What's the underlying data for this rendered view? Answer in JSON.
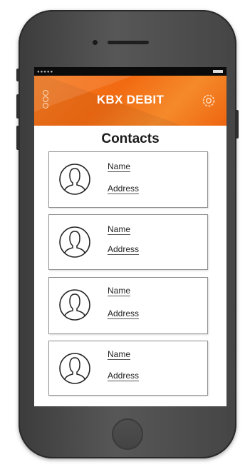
{
  "app": {
    "title": "KBX DEBIT",
    "accent_color": "#f47a1f"
  },
  "header": {
    "menu_icon": "menu-dots-icon",
    "settings_icon": "gear-icon"
  },
  "page": {
    "title": "Contacts"
  },
  "contacts": [
    {
      "name": "Name",
      "address": "Address",
      "avatar_icon": "person-icon"
    },
    {
      "name": "Name",
      "address": "Address",
      "avatar_icon": "person-icon"
    },
    {
      "name": "Name",
      "address": "Address",
      "avatar_icon": "person-icon"
    },
    {
      "name": "Name",
      "address": "Address",
      "avatar_icon": "person-icon"
    }
  ]
}
